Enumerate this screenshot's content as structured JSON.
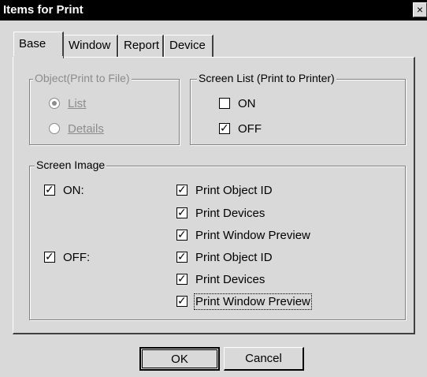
{
  "window": {
    "title": "Items for Print",
    "close_glyph": "×"
  },
  "tabs": [
    {
      "label": "Base",
      "active": true
    },
    {
      "label": "Window",
      "active": false
    },
    {
      "label": "Report",
      "active": false
    },
    {
      "label": "Device",
      "active": false
    }
  ],
  "object_group": {
    "label": "Object(Print to File)",
    "enabled": false,
    "options": [
      {
        "label": "List",
        "selected": true
      },
      {
        "label": "Details",
        "selected": false
      }
    ]
  },
  "screen_list_group": {
    "label": "Screen List (Print to Printer)",
    "options": [
      {
        "label": "ON",
        "checked": false
      },
      {
        "label": "OFF",
        "checked": true
      }
    ]
  },
  "screen_image_group": {
    "label": "Screen Image",
    "on": {
      "label": "ON:",
      "checked": true,
      "items": [
        {
          "label": "Print Object ID",
          "checked": true
        },
        {
          "label": "Print Devices",
          "checked": true
        },
        {
          "label": "Print Window Preview",
          "checked": true
        }
      ]
    },
    "off": {
      "label": "OFF:",
      "checked": true,
      "items": [
        {
          "label": "Print Object ID",
          "checked": true
        },
        {
          "label": "Print Devices",
          "checked": true
        },
        {
          "label": "Print Window Preview",
          "checked": true
        }
      ]
    }
  },
  "buttons": {
    "ok": "OK",
    "cancel": "Cancel"
  },
  "colors": {
    "dialog_bg": "#d9d9d9",
    "titlebar_bg": "#000000",
    "disabled_text": "#8c8c8c"
  }
}
